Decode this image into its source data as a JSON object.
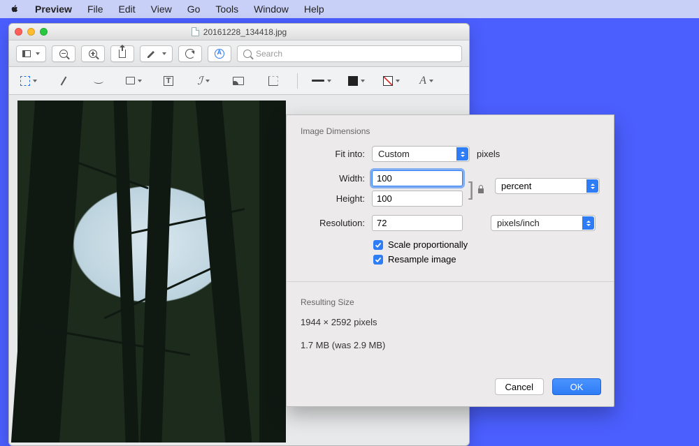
{
  "menubar": {
    "app": "Preview",
    "items": [
      "File",
      "Edit",
      "View",
      "Go",
      "Tools",
      "Window",
      "Help"
    ]
  },
  "window": {
    "title": "20161228_134418.jpg"
  },
  "search": {
    "placeholder": "Search"
  },
  "dialog": {
    "section1_title": "Image Dimensions",
    "fit_into_label": "Fit into:",
    "fit_into_value": "Custom",
    "fit_into_unit": "pixels",
    "width_label": "Width:",
    "width_value": "100",
    "height_label": "Height:",
    "height_value": "100",
    "wh_unit_value": "percent",
    "resolution_label": "Resolution:",
    "resolution_value": "72",
    "resolution_unit_value": "pixels/inch",
    "scale_label": "Scale proportionally",
    "resample_label": "Resample image",
    "section2_title": "Resulting Size",
    "result_dims": "1944 × 2592 pixels",
    "result_size": "1.7 MB (was 2.9 MB)",
    "cancel": "Cancel",
    "ok": "OK"
  }
}
